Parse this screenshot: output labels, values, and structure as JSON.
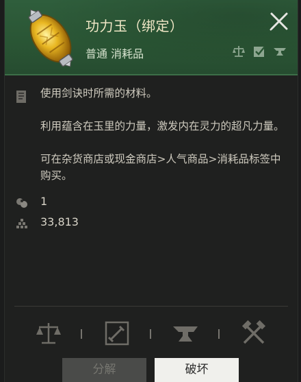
{
  "item": {
    "name": "功力玉（绑定）",
    "grade_type": "普通 消耗品",
    "icon": "yellow-jade-gem-icon"
  },
  "description": {
    "lines": [
      "使用剑诀时所需的材料。",
      "利用蕴含在玉里的力量，激发内在灵力的超凡力量。",
      "可在杂货商店或现金商店>人气商品>消耗品标签中购买。"
    ]
  },
  "stats": {
    "quantity": "1",
    "price": "33,813"
  },
  "header_icons": [
    "scale-icon",
    "checkbox-icon",
    "anvil-icon"
  ],
  "actions": [
    "scale-icon",
    "sword-scroll-icon",
    "anvil-icon",
    "crossed-hammers-icon"
  ],
  "buttons": {
    "disassemble": "分解",
    "destroy": "破坏"
  },
  "colors": {
    "header_green": "#2f5e3c",
    "title": "#f0e7c6",
    "panel": "#1f201f"
  }
}
